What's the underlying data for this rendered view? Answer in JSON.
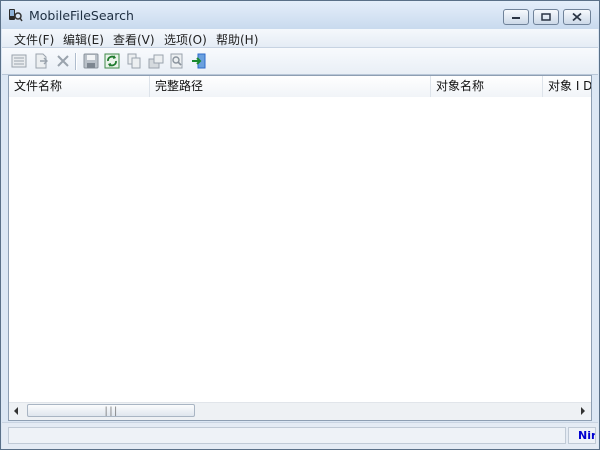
{
  "window": {
    "title": "MobileFileSearch"
  },
  "menu": {
    "items": [
      "文件(F)",
      "编辑(E)",
      "查看(V)",
      "选项(O)",
      "帮助(H)"
    ]
  },
  "listview": {
    "columns": [
      "文件名称",
      "完整路径",
      "对象名称",
      "对象 I D"
    ]
  },
  "status": {
    "link_text": "NirSoft"
  },
  "colors": {
    "link": "#0000d0",
    "accent": "#2c6ac9"
  },
  "icons": {
    "toolbar": [
      "properties-icon",
      "export-icon",
      "delete-icon",
      "save-icon",
      "refresh-icon",
      "copy-icon",
      "folder-options-icon",
      "find-icon",
      "exit-icon"
    ],
    "titlebar": [
      "app-icon",
      "minimize-icon",
      "maximize-icon",
      "close-icon"
    ]
  }
}
